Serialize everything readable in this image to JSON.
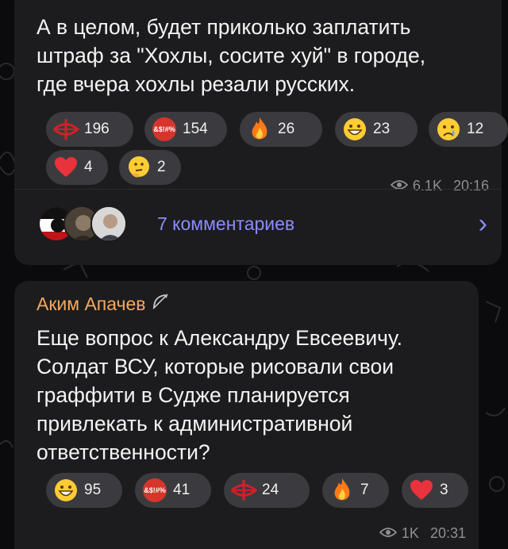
{
  "message1": {
    "text_lines": [
      "А в целом, будет приколько заплатить",
      "штраф за \"Хохлы, сосите хуй\" в городе,",
      "где вчера хохлы резали русских."
    ],
    "reactions": [
      {
        "icon": "crossbow-icon",
        "count": "196"
      },
      {
        "icon": "angry-censored-face-icon",
        "count": "154"
      },
      {
        "icon": "fire-icon",
        "count": "26"
      },
      {
        "icon": "grinning-face-icon",
        "count": "23"
      },
      {
        "icon": "crying-face-icon",
        "count": "12"
      },
      {
        "icon": "heart-icon",
        "count": "4"
      },
      {
        "icon": "thinking-face-icon",
        "count": "2"
      }
    ],
    "views": "6.1K",
    "time": "20:16",
    "comments_label": "7 комментариев"
  },
  "message2": {
    "author": "Аким Апачев",
    "text_lines": [
      "Еще вопрос к Александру Евсеевичу.",
      "Солдат ВСУ, которые рисовали свои",
      "граффити в Судже планируется",
      "привлекать к административной",
      "ответственности?"
    ],
    "reactions": [
      {
        "icon": "grinning-face-icon",
        "count": "95"
      },
      {
        "icon": "angry-censored-face-icon",
        "count": "41"
      },
      {
        "icon": "crossbow-icon",
        "count": "24"
      },
      {
        "icon": "fire-icon",
        "count": "7"
      },
      {
        "icon": "heart-icon",
        "count": "3"
      }
    ],
    "views": "1K",
    "time": "20:31"
  },
  "colors": {
    "background": "#0b0b0d",
    "bubble": "#1c1c1e",
    "reaction_pill": "#3b3b3f",
    "link": "#8c8cff",
    "author": "#f7a95b",
    "meta": "#8e8e93"
  }
}
